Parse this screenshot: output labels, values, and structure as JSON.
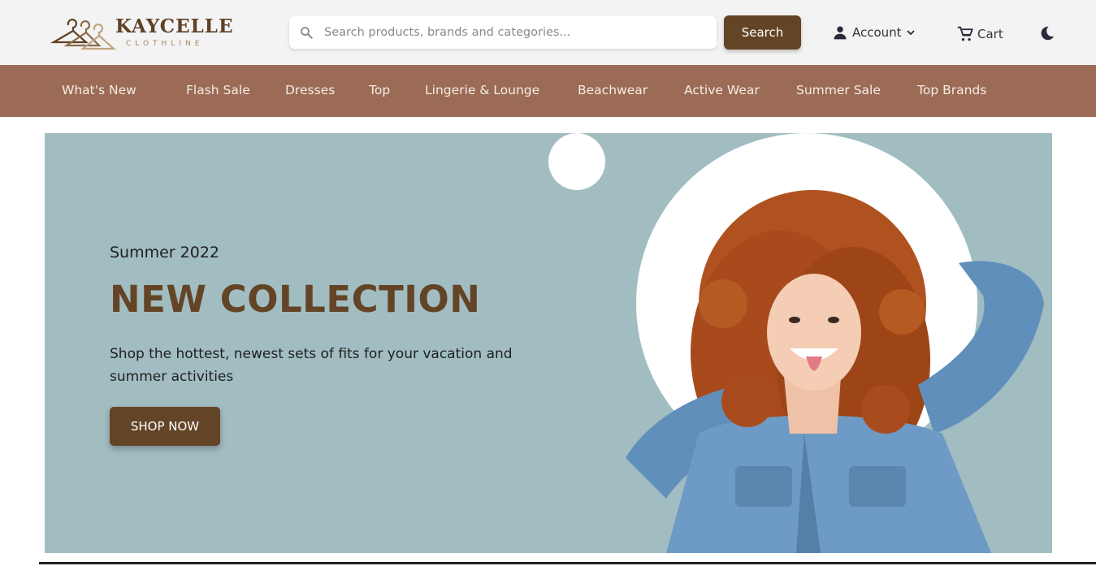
{
  "brand": {
    "name": "KAYCELLE",
    "tagline": "CLOTHLINE",
    "logo_icon": "hanger-icon",
    "primary_color": "#644426",
    "nav_color": "#9b6b55",
    "hero_bg_color": "#a1bdc1"
  },
  "search": {
    "placeholder": "Search products, brands and categories...",
    "value": "",
    "button_label": "Search",
    "icon": "search-icon"
  },
  "header_actions": {
    "account_label": "Account",
    "account_icon": "user-icon",
    "cart_label": "Cart",
    "cart_icon": "cart-icon",
    "theme_icon": "moon-icon"
  },
  "nav": {
    "items": [
      {
        "label": "What's New"
      },
      {
        "label": "Flash Sale"
      },
      {
        "label": "Dresses"
      },
      {
        "label": "Top"
      },
      {
        "label": "Lingerie & Lounge"
      },
      {
        "label": "Beachwear"
      },
      {
        "label": "Active Wear"
      },
      {
        "label": "Summer Sale"
      },
      {
        "label": "Top Brands"
      }
    ]
  },
  "hero": {
    "season": "Summer 2022",
    "title": "NEW COLLECTION",
    "description": "Shop the hottest, newest sets of fits for your vacation and summer activities",
    "cta_label": "SHOP NOW"
  }
}
